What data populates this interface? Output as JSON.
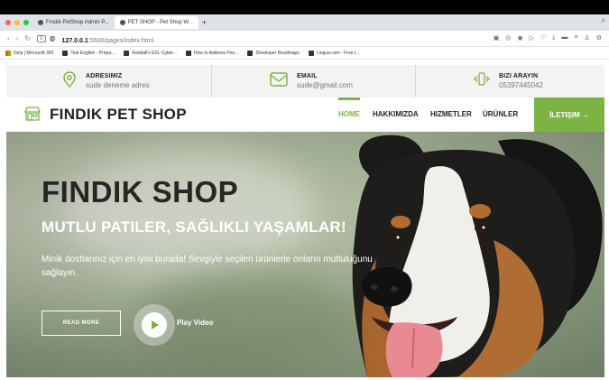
{
  "browser": {
    "tabs": [
      {
        "label": "Fındık PetShop Admin P..."
      },
      {
        "label": "PET SHOP - Pet Shop W..."
      }
    ],
    "new_tab": "+",
    "url_host": "127.0.0.1",
    "url_path": ":5500/pages/index.html",
    "bookmarks": [
      "Giriş | Microsoft 365",
      "Test English - Prepa...",
      "Randall's ESL Cyber...",
      "How to Address Peo...",
      "Developer Roadmaps",
      "Lingua.com - Free t..."
    ]
  },
  "contact": {
    "address_title": "ADRESIMIZ",
    "address_value": "sude deneme adres",
    "email_title": "EMAIL",
    "email_value": "sude@gmail.com",
    "phone_title": "BIZI ARAYIN",
    "phone_value": "05397445042"
  },
  "nav": {
    "logo": "FINDIK PET SHOP",
    "links": [
      "HOME",
      "HAKKIMIZDA",
      "HIZMETLER",
      "ÜRÜNLER"
    ],
    "cta": "İLETIŞIM →"
  },
  "hero": {
    "title": "FINDIK SHOP",
    "subtitle": "MUTLU PATILER, SAĞLIKLI YAŞAMLAR!",
    "description": "Minik dostlarınız için en iyisi burada! Sevgiyle seçilen ürünlerle onların mutluluğunu sağlayın.",
    "read_more": "READ MORE",
    "play_video": "Play Video"
  },
  "colors": {
    "accent": "#7cb342",
    "contact_bg": "#f3f3f3"
  }
}
